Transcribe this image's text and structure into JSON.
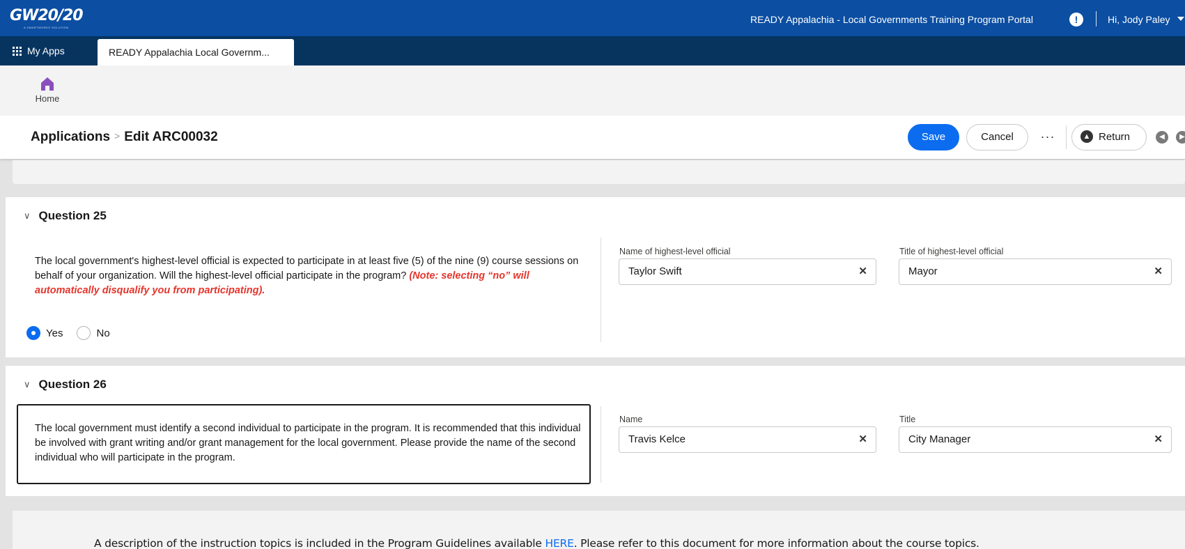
{
  "header": {
    "logo_text": "GW20/20",
    "logo_tagline": "A SMARTWORKS SOLUTION",
    "portal_title": "READY Appalachia - Local Governments Training Program Portal",
    "alert_icon": "exclamation-circle-icon",
    "user_greeting": "Hi, Jody Paley"
  },
  "tabs": {
    "my_apps_label": "My Apps",
    "active_tab_label": "READY Appalachia Local Governm..."
  },
  "nav": {
    "home_label": "Home"
  },
  "page": {
    "breadcrumb_parent": "Applications",
    "breadcrumb_separator": ">",
    "breadcrumb_current": "Edit ARC00032",
    "save_label": "Save",
    "cancel_label": "Cancel",
    "more_label": "···",
    "return_label": "Return"
  },
  "q25": {
    "title": "Question 25",
    "text": "The local government's highest-level official is expected to participate in at least five (5) of the nine (9) course sessions on behalf of your organization. Will the highest-level official participate in the program?",
    "note": "(Note: selecting “no” will automatically disqualify you from participating).",
    "name_label": "Name of highest-level official",
    "name_value": "Taylor Swift",
    "title_label": "Title of highest-level official",
    "title_value": "Mayor",
    "options": [
      "Yes",
      "No"
    ],
    "selected": "Yes"
  },
  "q26": {
    "title": "Question 26",
    "text": "The local government must identify a second individual to participate in the program. It is recommended that this individual be involved with grant writing and/or grant management for the local government. Please provide the name of the second individual who will participate in the program.",
    "name_label": "Name",
    "name_value": "Travis Kelce",
    "title_label": "Title",
    "title_value": "City Manager"
  },
  "footer": {
    "text_before": "A description of the instruction topics is included in the Program Guidelines available ",
    "link_text": "HERE",
    "text_after": ". Please refer to this document for more information about the course topics."
  },
  "colors": {
    "header_blue": "#0b4ea2",
    "tabbar_navy": "#06345f",
    "brand_button": "#0b6cf0",
    "note_red": "#e5352c",
    "home_icon_purple": "#8a4fbd"
  }
}
